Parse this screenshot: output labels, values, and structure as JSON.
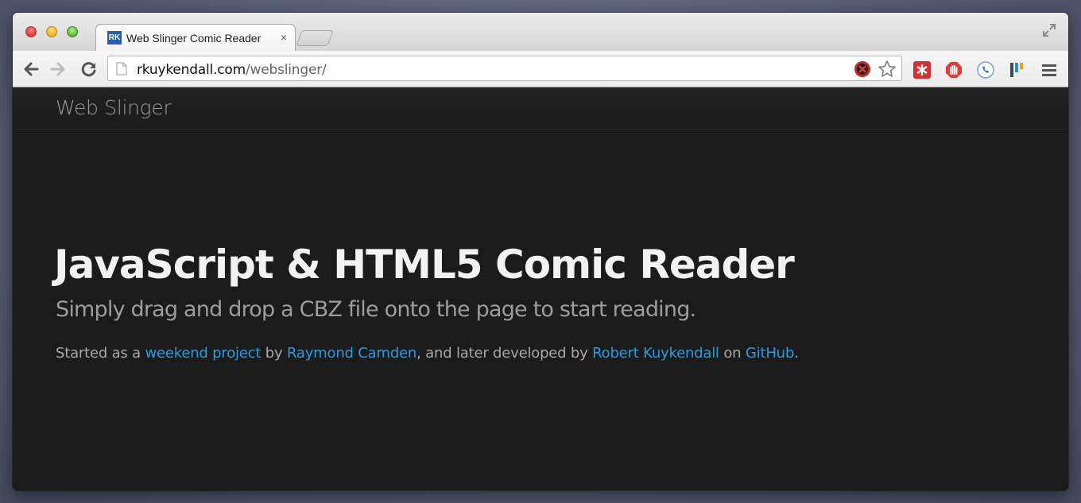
{
  "tab": {
    "title": "Web Slinger Comic Reader",
    "close": "×",
    "favicon_text": "RK"
  },
  "omnibox": {
    "domain": "rkuykendall.com",
    "path": "/webslinger/"
  },
  "navbar": {
    "brand": "Web Slinger"
  },
  "hero": {
    "title": "JavaScript & HTML5 Comic Reader",
    "subtitle": "Simply drag and drop a CBZ file onto the page to start reading.",
    "note": {
      "t1": "Started as a ",
      "link1": "weekend project",
      "t2": " by ",
      "link2": "Raymond Camden",
      "t3": ", and later developed by ",
      "link3": "Robert Kuykendall",
      "t4": " on ",
      "link4": "GitHub",
      "t5": "."
    }
  },
  "icons": {
    "back": "back-arrow-icon",
    "forward": "forward-arrow-icon",
    "reload": "reload-icon",
    "bookmark": "star-icon",
    "menu": "hamburger-menu-icon"
  },
  "colors": {
    "link": "#2a9bdc",
    "page_bg": "#1b1b1b",
    "title": "#f2f2f2"
  }
}
